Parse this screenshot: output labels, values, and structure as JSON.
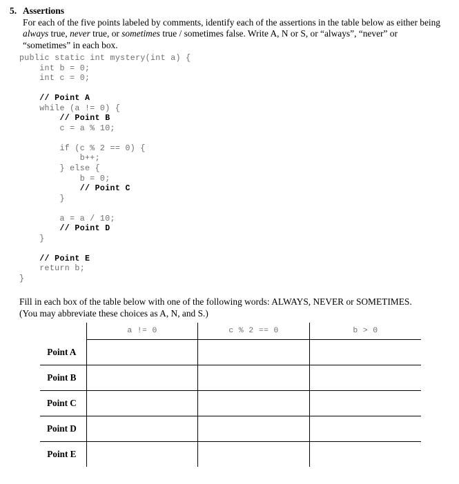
{
  "question": {
    "number": "5.",
    "title": "Assertions",
    "body_html": "For each of the five points labeled by comments, identify each of the assertions in the table below as either being <i>always</i> true, <i>never</i> true, or <i>sometimes</i> true / sometimes false. Write A, N or S, or “always”, “never” or “sometimes” in each box."
  },
  "code": {
    "language": "java",
    "lines": [
      {
        "text": "public static int mystery(int a) {",
        "comment": false
      },
      {
        "text": "    int b = 0;",
        "comment": false
      },
      {
        "text": "    int c = 0;",
        "comment": false
      },
      {
        "text": "",
        "comment": false
      },
      {
        "text": "    // Point A",
        "comment": true
      },
      {
        "text": "    while (a != 0) {",
        "comment": false
      },
      {
        "text": "        // Point B",
        "comment": true
      },
      {
        "text": "        c = a % 10;",
        "comment": false
      },
      {
        "text": "",
        "comment": false
      },
      {
        "text": "        if (c % 2 == 0) {",
        "comment": false
      },
      {
        "text": "            b++;",
        "comment": false
      },
      {
        "text": "        } else {",
        "comment": false
      },
      {
        "text": "            b = 0;",
        "comment": false
      },
      {
        "text": "            // Point C",
        "comment": true
      },
      {
        "text": "        }",
        "comment": false
      },
      {
        "text": "",
        "comment": false
      },
      {
        "text": "        a = a / 10;",
        "comment": false
      },
      {
        "text": "        // Point D",
        "comment": true
      },
      {
        "text": "    }",
        "comment": false
      },
      {
        "text": "",
        "comment": false
      },
      {
        "text": "    // Point E",
        "comment": true
      },
      {
        "text": "    return b;",
        "comment": false
      },
      {
        "text": "}",
        "comment": false
      }
    ]
  },
  "fill_instructions": {
    "line1": "Fill in each box of the table below with one of the following words: ALWAYS, NEVER or SOMETIMES.",
    "line2": "(You may abbreviate these choices as A, N, and S.)"
  },
  "table": {
    "corner_header": "",
    "columns": [
      "a != 0",
      "c % 2 == 0",
      "b > 0"
    ],
    "rows": [
      {
        "label": "Point A",
        "cells": [
          "",
          "",
          ""
        ]
      },
      {
        "label": "Point B",
        "cells": [
          "",
          "",
          ""
        ]
      },
      {
        "label": "Point C",
        "cells": [
          "",
          "",
          ""
        ]
      },
      {
        "label": "Point D",
        "cells": [
          "",
          "",
          ""
        ]
      },
      {
        "label": "Point E",
        "cells": [
          "",
          "",
          ""
        ]
      }
    ]
  }
}
